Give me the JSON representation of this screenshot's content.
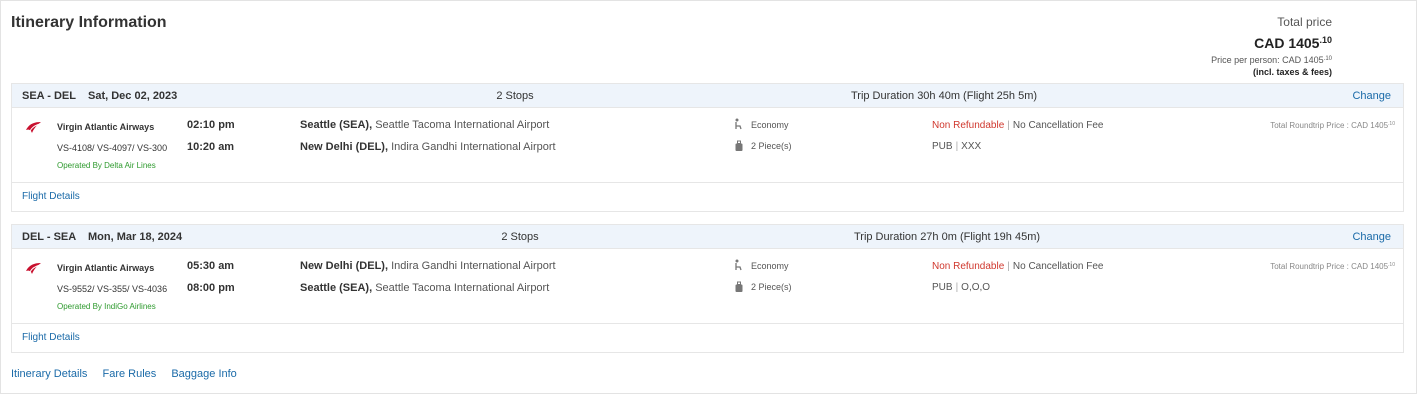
{
  "header": {
    "title": "Itinerary Information",
    "price_label": "Total price",
    "currency": "CAD",
    "price_whole": "1405",
    "price_fraction": ".10",
    "per_person_label": "Price per person: CAD 1405",
    "per_person_fraction": ".10",
    "incl_note": "(incl. taxes & fees)"
  },
  "legs": [
    {
      "route": "SEA - DEL",
      "date": "Sat, Dec 02, 2023",
      "stops": "2 Stops",
      "duration": "Trip Duration 30h 40m (Flight 25h 5m)",
      "change_label": "Change",
      "airline": "Virgin Atlantic Airways",
      "flights": "VS-4108/ VS-4097/ VS-300",
      "operated": "Operated By Delta Air Lines",
      "depart_time": "02:10 pm",
      "arrive_time": "10:20 am",
      "origin_code": "Seattle (SEA),",
      "origin_name": "Seattle Tacoma International Airport",
      "dest_code": "New Delhi (DEL),",
      "dest_name": "Indira Gandhi International Airport",
      "cabin": "Economy",
      "baggage": "2 Piece(s)",
      "refund_status": "Non Refundable",
      "cancel_fee": "No Cancellation Fee",
      "fare_code": "PUB",
      "fare_basis": "XXX",
      "roundtrip_label": "Total Roundtrip Price : CAD 1405",
      "roundtrip_fraction": ".10",
      "details_label": "Flight Details"
    },
    {
      "route": "DEL - SEA",
      "date": "Mon, Mar 18, 2024",
      "stops": "2 Stops",
      "duration": "Trip Duration 27h 0m (Flight 19h 45m)",
      "change_label": "Change",
      "airline": "Virgin Atlantic Airways",
      "flights": "VS-9552/ VS-355/ VS-4036",
      "operated": "Operated By IndiGo Airlines",
      "depart_time": "05:30 am",
      "arrive_time": "08:00 pm",
      "origin_code": "New Delhi (DEL),",
      "origin_name": "Indira Gandhi International Airport",
      "dest_code": "Seattle (SEA),",
      "dest_name": "Seattle Tacoma International Airport",
      "cabin": "Economy",
      "baggage": "2 Piece(s)",
      "refund_status": "Non Refundable",
      "cancel_fee": "No Cancellation Fee",
      "fare_code": "PUB",
      "fare_basis": "O,O,O",
      "roundtrip_label": "Total Roundtrip Price : CAD 1405",
      "roundtrip_fraction": ".10",
      "details_label": "Flight Details"
    }
  ],
  "footer": {
    "itinerary_details": "Itinerary Details",
    "fare_rules": "Fare Rules",
    "baggage_info": "Baggage Info"
  },
  "colors": {
    "link": "#1a6aa8",
    "non_refundable": "#d0382e",
    "operated": "#2e9a2e",
    "leg_header_bg": "#eef4fb",
    "airline_logo": "#c8102e"
  },
  "icons": {
    "airline_logo": "virgin-atlantic-logo-icon",
    "cabin": "seat-icon",
    "baggage": "luggage-icon"
  }
}
